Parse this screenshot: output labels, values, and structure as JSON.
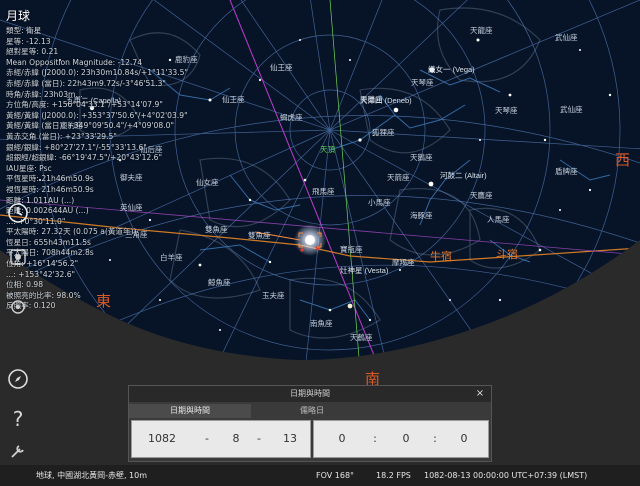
{
  "object": {
    "name": "月球",
    "info": [
      "類型: 衛星",
      "星等: -12.13",
      "絕對星等: 0.21",
      "Mean Opposition Magnitude: -12.74",
      "赤經/赤緯 (J2000.0): 23h30m10.84s/+1°11'33.5\"",
      "赤經/赤緯 (當日): 22h43m9.72s/-3°46'51.3\"",
      "時角/赤緯: 23h03m...",
      "方位角/高度: +156°04'33.1\"/+53°14'07.9\"",
      "黃經/黃緯 (J2000.0): +353°37'50.6\"/+4°02'03.9\"",
      "黃經/黃緯 (當日): +349°09'50.4\"/+4°09'08.0\"",
      "黃赤交角 (當日): +23°33'29.5\"",
      "銀經/銀緯: +80°27'27.1\"/-55°33'13.6\"",
      "超銀經/超銀緯: -66°19'47.5\"/+20°43'12.6\"",
      "IAU星座: Psc",
      "平恆星時: 21h46m50.9s",
      "視恆星時: 21h46m50.9s",
      "距離: 1.011AU (...)",
      "距離: 0.002644AU (...)",
      "...: +0°30'11.0\"",
      "平太陽時: 27.32天 (0.075 a(黃道年))",
      "恆星日: 655h43m11.5s",
      "平太陽日: 708h44m2.8s",
      "位角: +16°14'56.2\"",
      "...: +153°42'32.6\"",
      "位相: 0.98",
      "被照亮的比率: 98.0%",
      "反照率: 0.120"
    ]
  },
  "compass": {
    "east": "東",
    "south": "南",
    "west": "西"
  },
  "ecliptic_labels": {
    "niu": "牛宿",
    "dou": "斗宿"
  },
  "constellations": [
    "鹿豹座",
    "鹿豹座",
    "仙王座",
    "仙王座",
    "天龍座",
    "天琴座",
    "天琴座",
    "武仙座",
    "武仙座",
    "仙后座",
    "仙女座",
    "蝎虎座",
    "天鵝座",
    "天鵝座",
    "天鷹座",
    "天箭座",
    "狐狸座",
    "海豚座",
    "小馬座",
    "飛馬座",
    "寶瓶座",
    "雙魚座",
    "雙魚座",
    "鯨魚座",
    "摩羯座",
    "盾牌座",
    "人馬座",
    "南魚座",
    "玉夫座",
    "天鶴座",
    "英仙座",
    "三角座",
    "白羊座",
    "御夫座",
    "天頂"
  ],
  "star_labels": {
    "vega": "織女一 (Vega)",
    "deneb": "天津四 (Deneb)",
    "altair": "河鼓二 (Altair)",
    "capella": "五車二 (Capella)",
    "vesta": "灶神星 (Vesta)"
  },
  "dialog": {
    "title": "日期與時間",
    "close": "×",
    "tab_datetime": "日期與時間",
    "tab_jd": "儒略日",
    "year": "1082",
    "sep1": "-",
    "month": "8",
    "sep2": "-",
    "day": "13",
    "hour": "0",
    "colon1": ":",
    "minute": "0",
    "colon2": ":",
    "second": "0"
  },
  "status": {
    "location": "地球, 中國湖北黃岡-赤壁, 10m",
    "fov": "FOV 168°",
    "fps": "18.2 FPS",
    "datetime": "1082-08-13 00:00:00 UTC+07:39 (LMST)"
  },
  "icons": [
    "clock-icon",
    "location-icon",
    "compass-icon",
    "help-icon",
    "tool-icon"
  ],
  "colors": {
    "sky": "#071428",
    "grid": "#4a6fa6",
    "ecliptic": "#d07a24",
    "meridian": "#c03ad0",
    "compass_label": "#d85a25",
    "ground": "#2a2a2a"
  }
}
